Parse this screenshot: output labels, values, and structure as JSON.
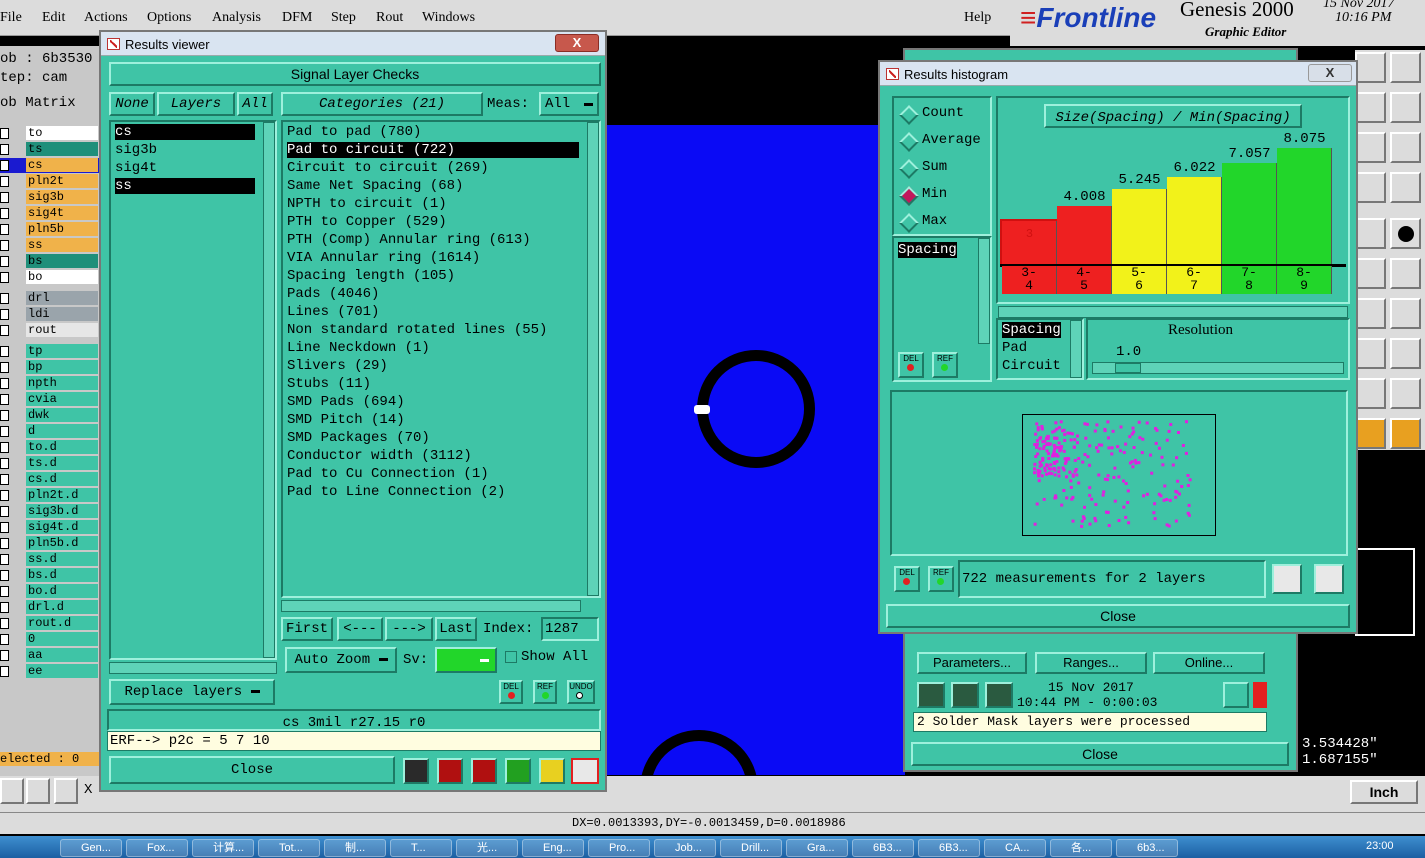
{
  "app": {
    "menus": [
      "File",
      "Edit",
      "Actions",
      "Options",
      "Analysis",
      "DFM",
      "Step",
      "Rout",
      "Windows"
    ],
    "help": "Help",
    "brand": "Frontline",
    "title": "Genesis 2000",
    "subtitle": "Graphic Editor",
    "date": "15 Nov 2017",
    "time": "10:16 PM"
  },
  "left_panel": {
    "job": "ob : 6b3530",
    "step": "tep: cam",
    "job_matrix": "ob Matrix",
    "layers": [
      {
        "name": "to",
        "color": "#ffffff"
      },
      {
        "name": "ts",
        "color": "#1f8f7a"
      },
      {
        "name": "cs",
        "color": "#f0b24a"
      },
      {
        "name": "pln2t",
        "color": "#f0b24a"
      },
      {
        "name": "sig3b",
        "color": "#f0b24a"
      },
      {
        "name": "sig4t",
        "color": "#f0b24a"
      },
      {
        "name": "pln5b",
        "color": "#f0b24a"
      },
      {
        "name": "ss",
        "color": "#f0b24a"
      },
      {
        "name": "bs",
        "color": "#1f8f7a"
      },
      {
        "name": "bo",
        "color": "#ffffff"
      },
      {
        "name": "drl",
        "color": "#9aa4ab"
      },
      {
        "name": "ldi",
        "color": "#9aa4ab"
      },
      {
        "name": "rout",
        "color": "#e6e6e6"
      },
      {
        "name": "tp",
        "color": "#3fc4a6"
      },
      {
        "name": "bp",
        "color": "#3fc4a6"
      },
      {
        "name": "npth",
        "color": "#3fc4a6"
      },
      {
        "name": "cvia",
        "color": "#3fc4a6"
      },
      {
        "name": "dwk",
        "color": "#3fc4a6"
      },
      {
        "name": "d",
        "color": "#3fc4a6"
      },
      {
        "name": "to.d",
        "color": "#3fc4a6"
      },
      {
        "name": "ts.d",
        "color": "#3fc4a6"
      },
      {
        "name": "cs.d",
        "color": "#3fc4a6"
      },
      {
        "name": "pln2t.d",
        "color": "#3fc4a6"
      },
      {
        "name": "sig3b.d",
        "color": "#3fc4a6"
      },
      {
        "name": "sig4t.d",
        "color": "#3fc4a6"
      },
      {
        "name": "pln5b.d",
        "color": "#3fc4a6"
      },
      {
        "name": "ss.d",
        "color": "#3fc4a6"
      },
      {
        "name": "bs.d",
        "color": "#3fc4a6"
      },
      {
        "name": "bo.d",
        "color": "#3fc4a6"
      },
      {
        "name": "drl.d",
        "color": "#3fc4a6"
      },
      {
        "name": "rout.d",
        "color": "#3fc4a6"
      },
      {
        "name": "0",
        "color": "#3fc4a6"
      },
      {
        "name": "aa",
        "color": "#3fc4a6"
      },
      {
        "name": "ee",
        "color": "#3fc4a6"
      }
    ],
    "selected": "elected : 0"
  },
  "results_viewer": {
    "title": "Results viewer",
    "close_x": "X",
    "header": "Signal Layer Checks",
    "none_btn": "None",
    "layers_btn": "Layers",
    "all_btn": "All",
    "categories_btn": "Categories (21)",
    "meas_label": "Meas:",
    "meas_value": "All",
    "layer_list": [
      "cs",
      "sig3b",
      "sig4t",
      "ss"
    ],
    "categories": [
      "Pad to pad (780)",
      "Pad to circuit (722)",
      "Circuit to circuit (269)",
      "Same Net Spacing (68)",
      "NPTH to circuit (1)",
      "PTH to Copper (529)",
      "PTH (Comp) Annular ring (613)",
      "VIA Annular ring (1614)",
      "Spacing length (105)",
      "Pads (4046)",
      "Lines (701)",
      "Non standard rotated lines (55)",
      "Line Neckdown (1)",
      "Slivers (29)",
      "Stubs (11)",
      "SMD Pads (694)",
      "SMD Pitch (14)",
      "SMD Packages (70)",
      "Conductor width (3112)",
      "Pad to Cu Connection (1)",
      "Pad to Line Connection (2)"
    ],
    "first": "First",
    "prev": "<---",
    "next": "--->",
    "last": "Last",
    "index_label": "Index:",
    "index_value": "1287",
    "auto_zoom": "Auto Zoom",
    "sv_label": "Sv:",
    "show_all": "Show All",
    "replace_layers": "Replace layers",
    "del": "DEL",
    "ref": "REF",
    "undo": "UNDO",
    "info": "cs 3mil  r27.15  r0",
    "erf": "ERF--> p2c = 5 7 10",
    "close": "Close"
  },
  "histogram": {
    "title": "Results histogram",
    "close_x": "X",
    "modes": [
      "Count",
      "Average",
      "Sum",
      "Min",
      "Max"
    ],
    "selected_mode": "Min",
    "spacing_item": "Spacing",
    "chart_title": "Size(Spacing) / Min(Spacing)",
    "bars": [
      {
        "value": "3",
        "bin": "3-\n4",
        "color": "#ee2020"
      },
      {
        "value": "4.008",
        "bin": "4-\n5",
        "color": "#ee2020"
      },
      {
        "value": "5.245",
        "bin": "5-\n6",
        "color": "#f2f21a"
      },
      {
        "value": "6.022",
        "bin": "6-\n7",
        "color": "#f2f21a"
      },
      {
        "value": "7.057",
        "bin": "7-\n8",
        "color": "#22d62a"
      },
      {
        "value": "8.075",
        "bin": "8-\n9",
        "color": "#22d62a"
      }
    ],
    "param_list": [
      "Spacing",
      "Pad",
      "Circuit"
    ],
    "resolution_label": "Resolution",
    "resolution_value": "1.0",
    "status": "722 measurements for 2 layers",
    "del": "DEL",
    "ref": "REF",
    "close": "Close"
  },
  "checklist": {
    "parameters": "Parameters...",
    "ranges": "Ranges...",
    "online": "Online...",
    "date": "15 Nov 2017",
    "time": "10:44 PM - 0:00:03",
    "message": "2 Solder Mask layers were processed",
    "close": "Close"
  },
  "coords": {
    "x": "3.534428\"",
    "y": "1.687155\"",
    "units": "Inch"
  },
  "status_bar": "DX=0.0013393,DY=-0.0013459,D=0.0018986",
  "taskbar": {
    "items": [
      "Gen...",
      "Fox...",
      "计算...",
      "Tot...",
      "制...",
      "T...",
      "光...",
      "Eng...",
      "Pro...",
      "Job...",
      "Drill...",
      "Gra...",
      "6B3...",
      "6B3...",
      "CA...",
      "各...",
      "6b3..."
    ],
    "clock": "23:00"
  },
  "x_label": "X"
}
